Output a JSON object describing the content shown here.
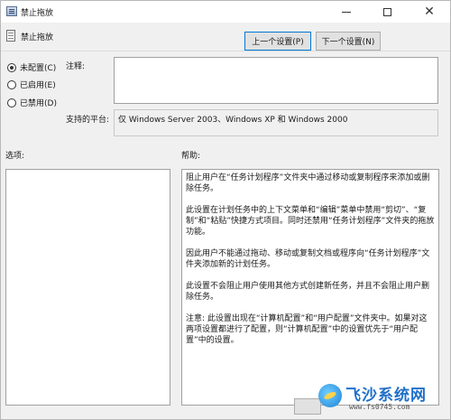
{
  "window": {
    "title": "禁止拖放",
    "accent": "#0078d7"
  },
  "policy": {
    "name": "禁止拖放"
  },
  "nav": {
    "prev_label": "上一个设置(P)",
    "next_label": "下一个设置(N)"
  },
  "state": {
    "options": [
      {
        "label": "未配置(C)",
        "checked": true
      },
      {
        "label": "已启用(E)",
        "checked": false
      },
      {
        "label": "已禁用(D)",
        "checked": false
      }
    ]
  },
  "comment": {
    "label": "注释:",
    "value": ""
  },
  "platform": {
    "label": "支持的平台:",
    "value": "仅 Windows Server 2003、Windows XP 和 Windows 2000"
  },
  "options_panel": {
    "label": "选项:"
  },
  "help": {
    "label": "帮助:",
    "paragraphs": [
      "阻止用户在“任务计划程序”文件夹中通过移动或复制程序来添加或删除任务。",
      "此设置在计划任务中的上下文菜单和“编辑”菜单中禁用“剪切”、“复制”和“粘贴”快捷方式项目。同时还禁用“任务计划程序”文件夹的拖放功能。",
      "因此用户不能通过拖动、移动或复制文档或程序向“任务计划程序”文件夹添加新的计划任务。",
      "此设置不会阻止用户使用其他方式创建新任务，并且不会阻止用户删除任务。",
      "注意: 此设置出现在“计算机配置”和“用户配置”文件夹中。如果对这两项设置都进行了配置，则“计算机配置”中的设置优先于“用户配置”中的设置。"
    ]
  },
  "watermark": {
    "text": "飞沙系统网",
    "url": "www.fs0745.com"
  }
}
